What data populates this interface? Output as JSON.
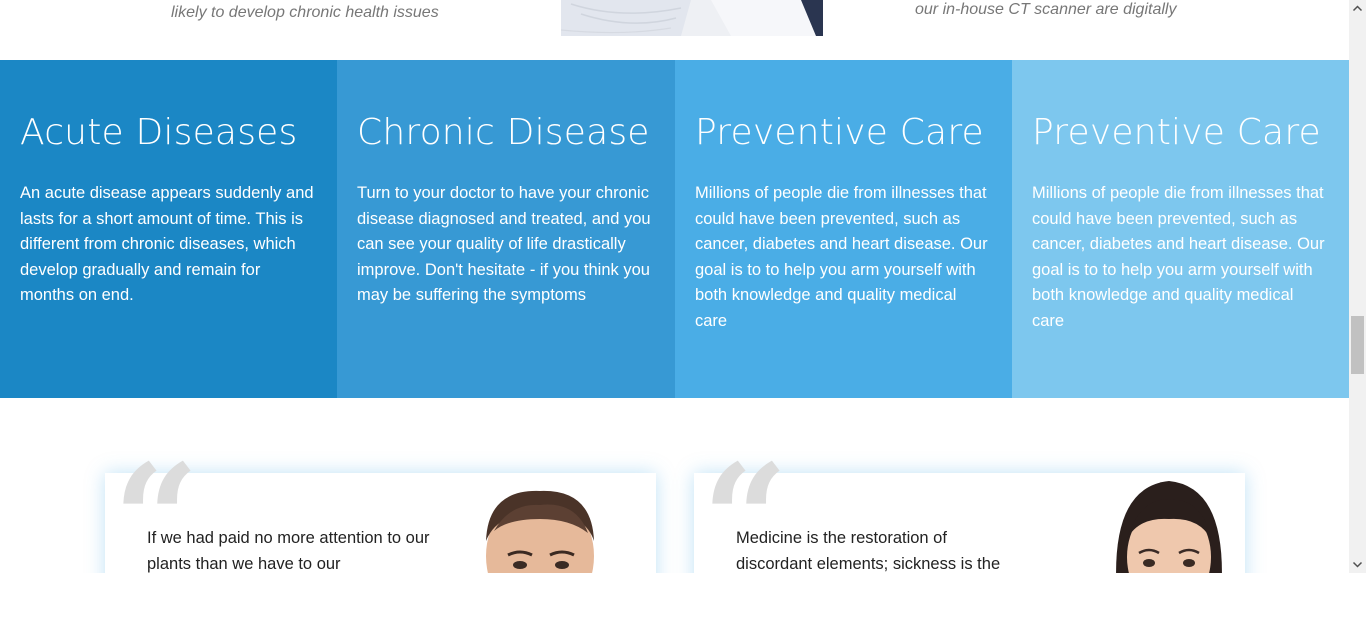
{
  "top": {
    "left_caption": "likely to develop chronic health issues",
    "right_caption": "our in-house CT scanner are digitally"
  },
  "features": [
    {
      "title": "Acute Diseases",
      "text": "An acute disease appears suddenly and lasts for a short amount of time. This is different from chronic diseases, which develop gradually and remain for months on end.",
      "color": "#1b87c5"
    },
    {
      "title": "Chronic Disease",
      "text": "Turn to your doctor to have your chronic disease diagnosed and treated, and you can see your quality of life drastically improve. Don't hesitate - if you think you may be suffering the symptoms",
      "color": "#3799d4"
    },
    {
      "title": "Preventive Care",
      "text": "Millions of people die from illnesses that could have been prevented, such as cancer, diabetes and heart disease. Our goal is to to help you arm yourself with both knowledge and quality medical care",
      "color": "#4aade6"
    },
    {
      "title": "Preventive Care",
      "text": "Millions of people die from illnesses that could have been prevented, such as cancer, diabetes and heart disease. Our goal is to to help you arm yourself with both knowledge and quality medical care",
      "color": "#7dc7ee"
    }
  ],
  "testimonials": [
    {
      "quote": "If we had paid no more attention to our plants than we have to our",
      "avatar": "male-avatar"
    },
    {
      "quote": "Medicine is the restoration of discordant elements; sickness is the",
      "avatar": "female-avatar"
    }
  ],
  "quote_glyph": "“"
}
